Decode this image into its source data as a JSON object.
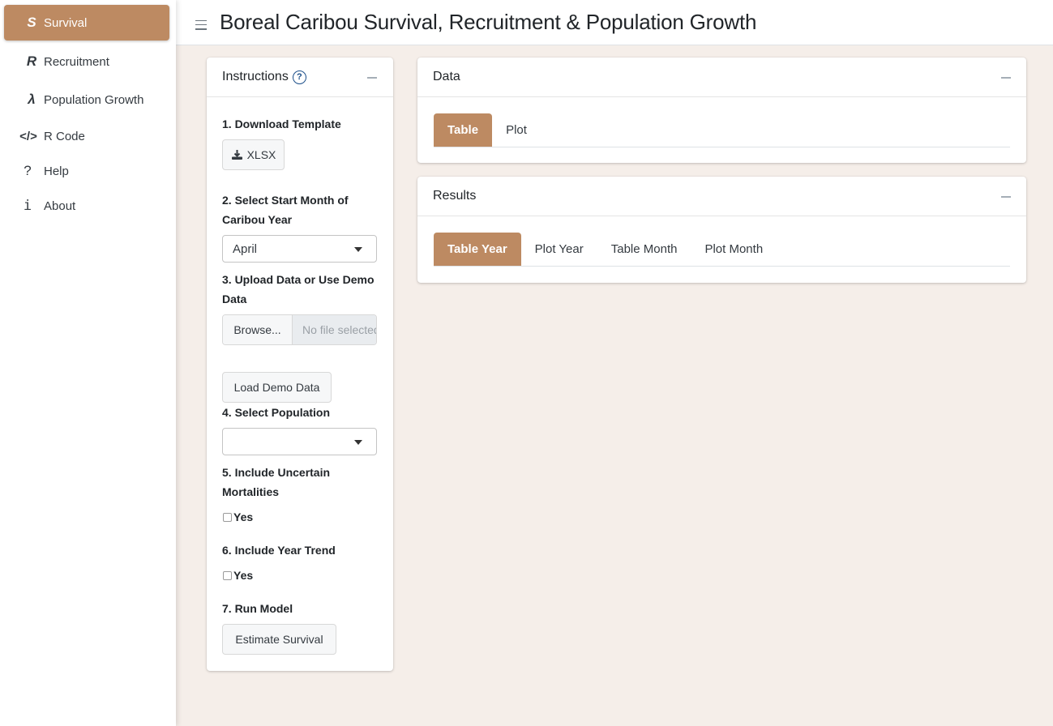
{
  "app": {
    "title": "Boreal Caribou Survival, Recruitment & Population Growth",
    "accent_color": "#bd8a62"
  },
  "sidebar": {
    "items": [
      {
        "label": "Survival",
        "icon": "S",
        "icon_name": "survival-s-icon",
        "active": true
      },
      {
        "label": "Recruitment",
        "icon": "R",
        "icon_name": "recruitment-r-icon",
        "active": false
      },
      {
        "label": "Population Growth",
        "icon": "λ",
        "icon_name": "lambda-icon",
        "active": false
      },
      {
        "label": "R Code",
        "icon": "</>",
        "icon_name": "code-icon",
        "active": false
      },
      {
        "label": "Help",
        "icon": "?",
        "icon_name": "question-icon",
        "active": false
      },
      {
        "label": "About",
        "icon": "i",
        "icon_name": "info-icon",
        "active": false
      }
    ]
  },
  "instructions": {
    "title": "Instructions",
    "help_icon": "?",
    "steps": {
      "download": "1. Download Template",
      "download_button": "XLSX",
      "start_month": "2. Select Start Month of Caribou Year",
      "start_month_value": "April",
      "upload": "3. Upload Data or Use Demo Data",
      "browse_button": "Browse...",
      "file_placeholder": "No file selected",
      "demo_button": "Load Demo Data",
      "population": "4. Select Population",
      "population_value": "",
      "uncertain": "5. Include Uncertain Mortalities",
      "uncertain_option": "Yes",
      "uncertain_checked": false,
      "trend": "6. Include Year Trend",
      "trend_option": "Yes",
      "trend_checked": false,
      "run": "7. Run Model",
      "run_button": "Estimate Survival"
    }
  },
  "data_panel": {
    "title": "Data",
    "tabs": [
      {
        "label": "Table",
        "active": true
      },
      {
        "label": "Plot",
        "active": false
      }
    ]
  },
  "results_panel": {
    "title": "Results",
    "tabs": [
      {
        "label": "Table Year",
        "active": true
      },
      {
        "label": "Plot Year",
        "active": false
      },
      {
        "label": "Table Month",
        "active": false
      },
      {
        "label": "Plot Month",
        "active": false
      }
    ]
  }
}
